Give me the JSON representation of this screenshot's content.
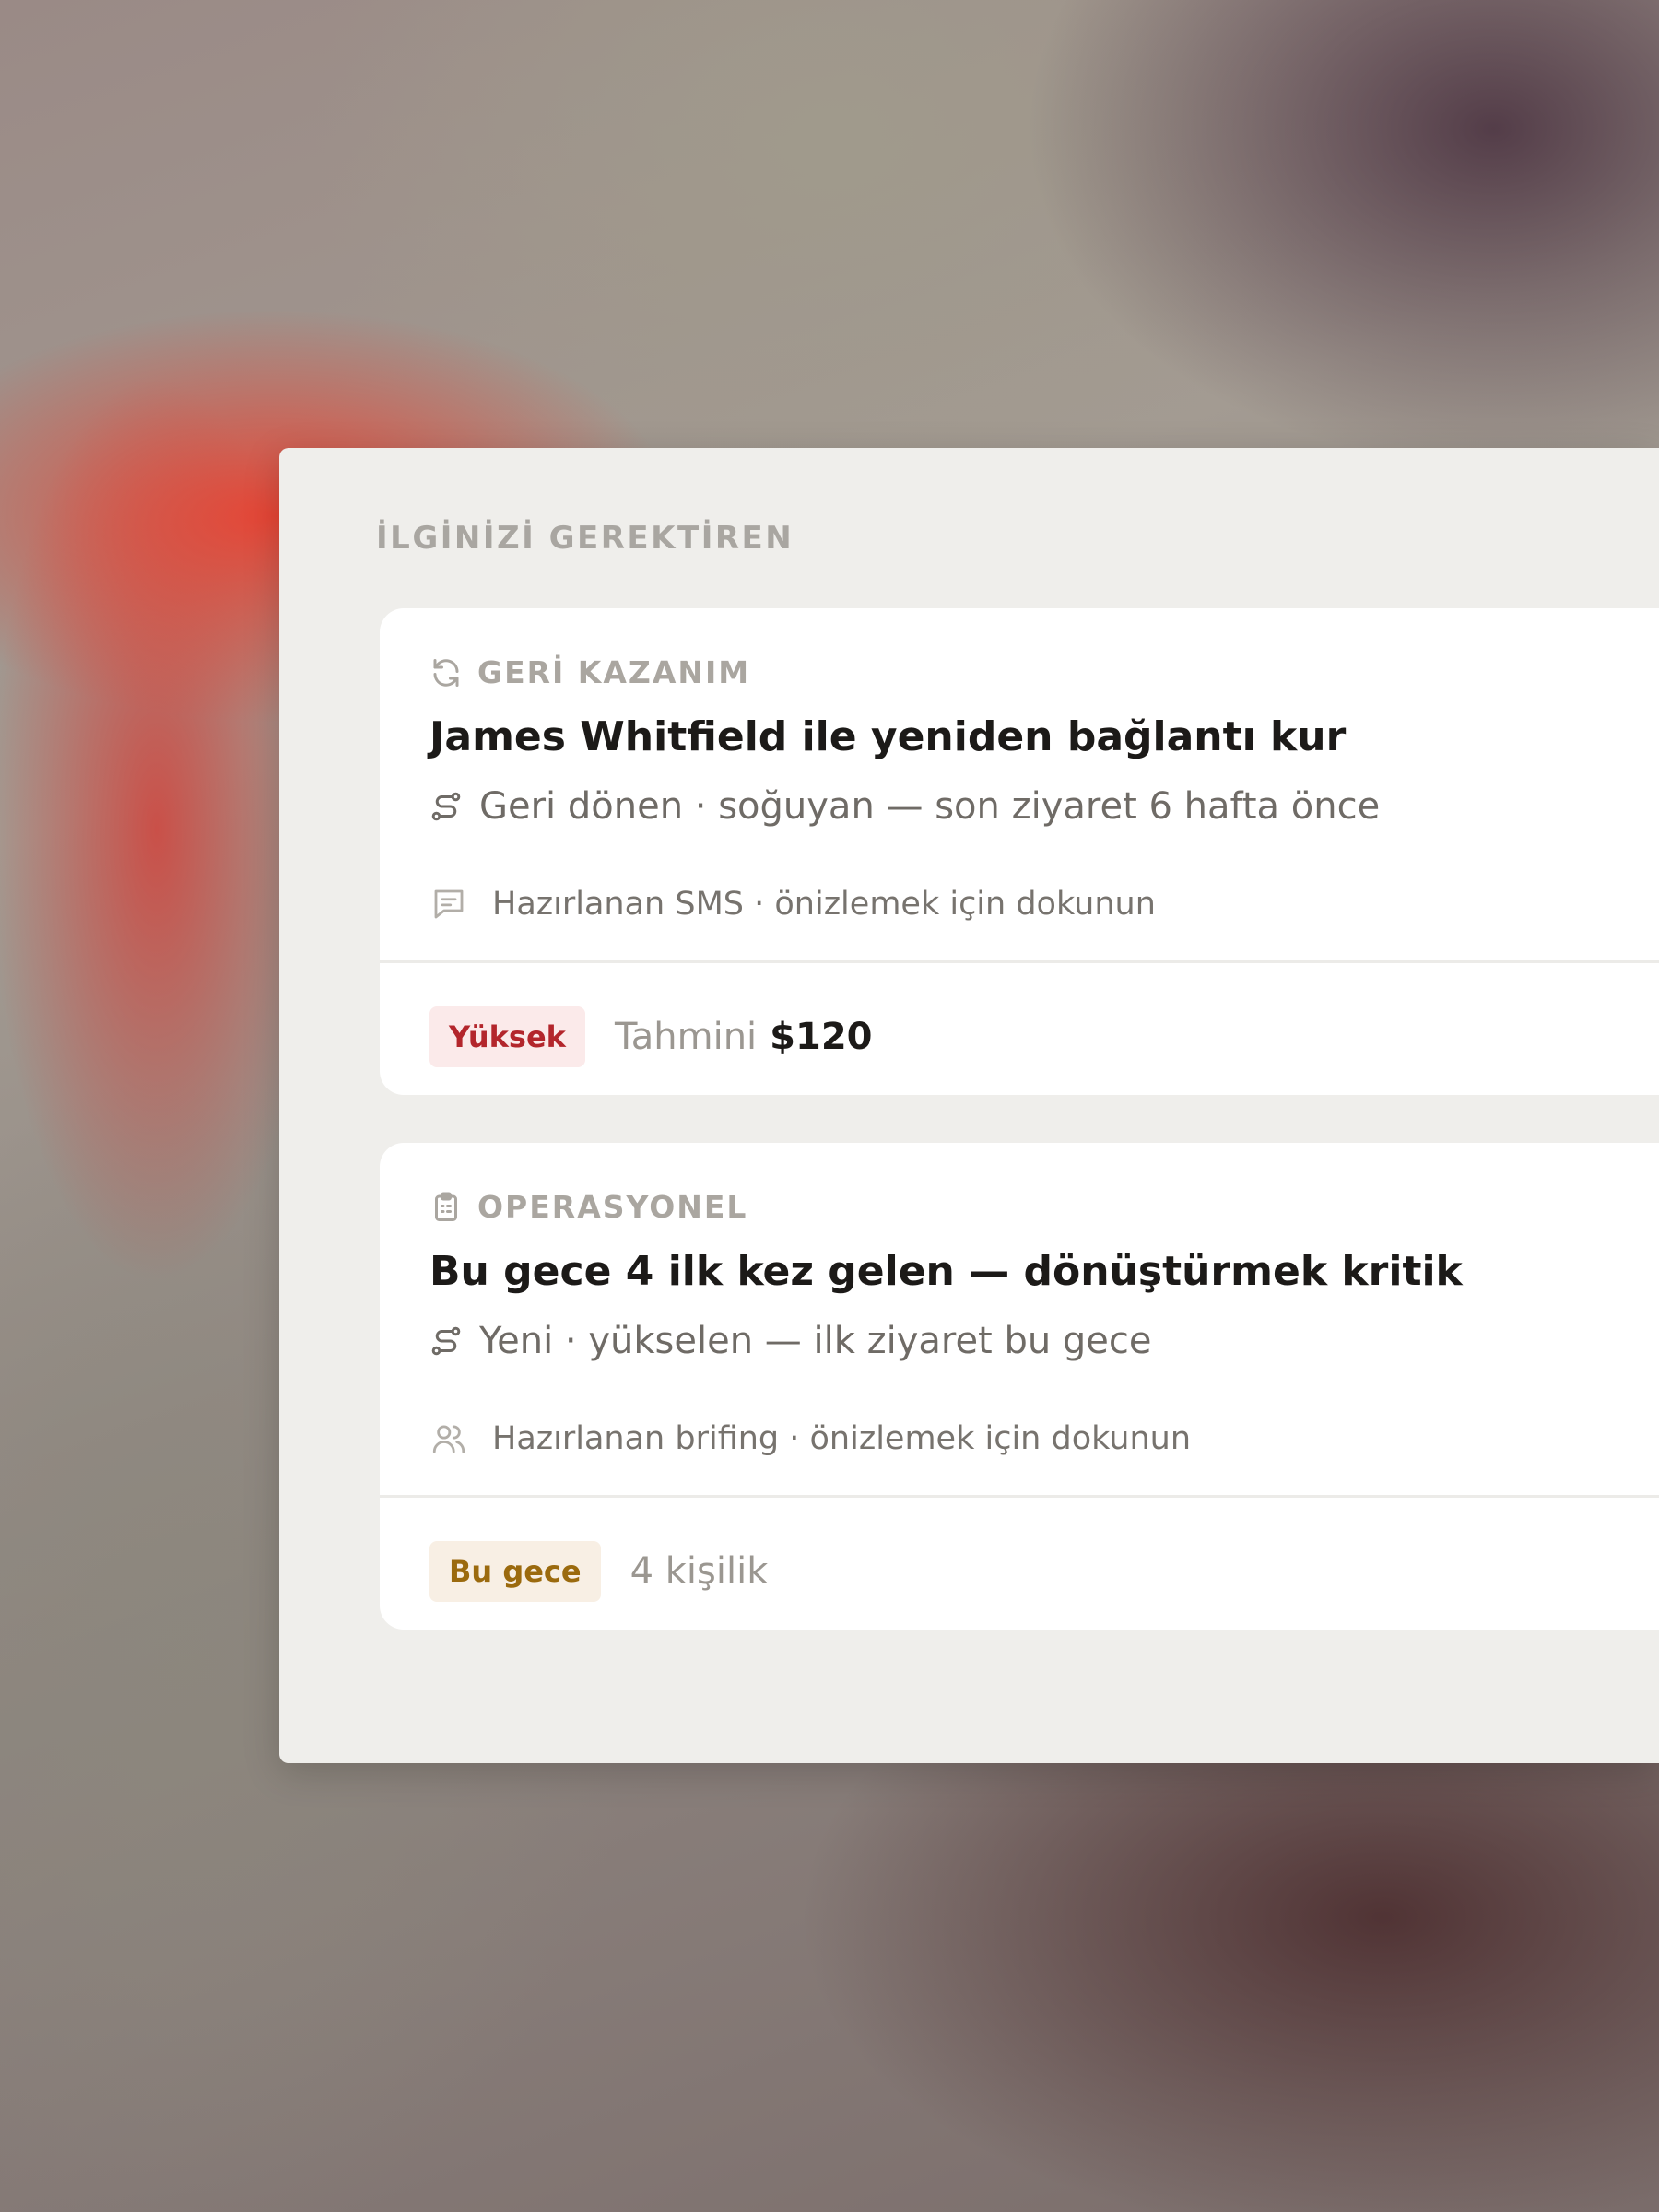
{
  "section": {
    "title": "İLGİNİZİ GEREKTİREN"
  },
  "cards": [
    {
      "category": "GERİ KAZANIM",
      "category_icon": "refresh-icon",
      "title": "James Whitfield ile yeniden bağlantı kur",
      "subtitle_icon": "route-icon",
      "subtitle": "Geri dönen · soğuyan — son ziyaret 6 hafta önce",
      "draft_icon": "message-icon",
      "draft": "Hazırlanan SMS · önizlemek için dokunun",
      "badge": "Yüksek",
      "badge_color": "#b3262c",
      "meta_label": "Tahmini",
      "meta_value": "$120"
    },
    {
      "category": "OPERASYONEL",
      "category_icon": "clipboard-icon",
      "title": "Bu gece 4 ilk kez gelen — dönüştürmek kritik",
      "subtitle_icon": "route-icon",
      "subtitle": "Yeni · yükselen — ilk ziyaret bu gece",
      "draft_icon": "users-icon",
      "draft": "Hazırlanan brifing · önizlemek için dokunun",
      "badge": "Bu gece",
      "badge_color": "#9b6a0e",
      "meta_label": "4 kişilik"
    }
  ]
}
